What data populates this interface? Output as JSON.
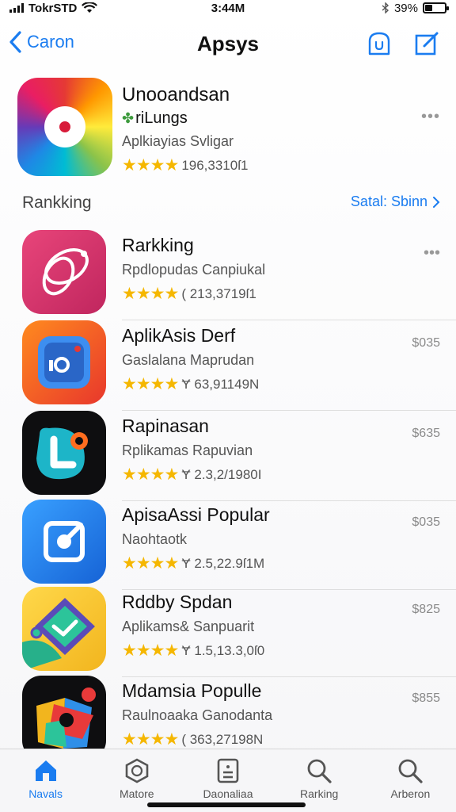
{
  "status_bar": {
    "carrier": "TokrSTD",
    "time": "3:44M",
    "battery": "39%",
    "battery_level": 0.39
  },
  "nav": {
    "back_label": "Caron",
    "title": "Apsys"
  },
  "featured": {
    "title": "Unooandsan",
    "tag": "riLungs",
    "subtitle": "Aplkiayias Svligar",
    "stars": "★★★★",
    "rating": "196,3310ſ1",
    "more": "•••"
  },
  "section": {
    "title": "Rankking",
    "link": "Satal: Sbinn"
  },
  "apps": [
    {
      "name": "Rarkking",
      "subtitle": "Rpdlopudas Canpiukal",
      "stars": "★★★★",
      "rating": "( 213,3719ſ1",
      "right": "•••"
    },
    {
      "name": "AplikAsis Derf",
      "subtitle": "Gaslalana Maprudan",
      "stars": "★★★★",
      "rating": "Ɏ 63,91149N",
      "right": "$035"
    },
    {
      "name": "Rapinasan",
      "subtitle": "Rplikamas Rapuvian",
      "stars": "★★★★",
      "rating": "Ɏ 2.3,2/1980I",
      "right": "$635"
    },
    {
      "name": "ApisaAssi Popular",
      "subtitle": "Naohtaotk",
      "stars": "★★★★",
      "rating": "Ɏ 2.5,22.9ſ1M",
      "right": "$035"
    },
    {
      "name": "Rddby Spdan",
      "subtitle": "Aplikams& Sanpuarit",
      "stars": "★★★★",
      "rating": "Ɏ 1.5,13.3,0ſ0",
      "right": "$825"
    },
    {
      "name": "Mdamsia Populle",
      "subtitle": "Raulnoaaka Ganodanta",
      "stars": "★★★★",
      "rating": "( 363,27198N",
      "right": "$855"
    }
  ],
  "tabs": [
    {
      "label": "Navals",
      "icon": "home-icon",
      "active": true
    },
    {
      "label": "Matore",
      "icon": "cube-icon",
      "active": false
    },
    {
      "label": "Daonaliaa",
      "icon": "document-icon",
      "active": false
    },
    {
      "label": "Rarking",
      "icon": "search-icon",
      "active": false
    },
    {
      "label": "Arberon",
      "icon": "search-icon",
      "active": false
    }
  ],
  "colors": {
    "accent": "#1a7cf0",
    "star": "#f5b700"
  }
}
